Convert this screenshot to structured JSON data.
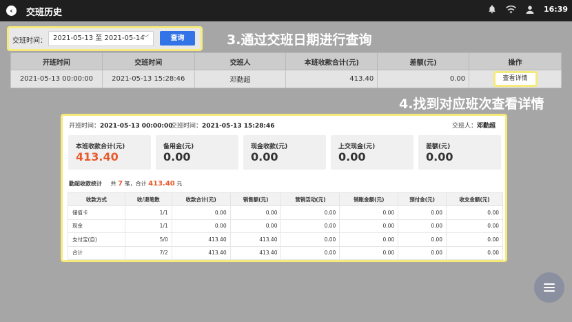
{
  "topbar": {
    "title": "交班历史",
    "time": "16:39"
  },
  "filter": {
    "label": "交班时间：",
    "date_range": "2021-05-13 至 2021-05-14",
    "query_button": "查询"
  },
  "annotations": {
    "step3": "3.通过交班日期进行查询",
    "step4": "4.找到对应班次查看详情"
  },
  "history_table": {
    "headers": [
      "开班时间",
      "交班时间",
      "交班人",
      "本班收款合计(元)",
      "差额(元)",
      "操作"
    ],
    "rows": [
      {
        "start": "2021-05-13 00:00:00",
        "end": "2021-05-13 15:28:46",
        "person": "邓勤超",
        "total": "413.40",
        "diff": "0.00",
        "action": "查看详情"
      }
    ]
  },
  "detail": {
    "start_label": "开班时间：",
    "start_value": "2021-05-13 00:00:00",
    "end_label": "交班时间：",
    "end_value": "2021-05-13 15:28:46",
    "person_label": "交班人：",
    "person_value": "邓勤超",
    "cards": [
      {
        "label": "本班收款合计(元)",
        "value": "413.40"
      },
      {
        "label": "备用金(元)",
        "value": "0.00"
      },
      {
        "label": "现金收款(元)",
        "value": "0.00"
      },
      {
        "label": "上交现金(元)",
        "value": "0.00"
      },
      {
        "label": "差额(元)",
        "value": "0.00"
      }
    ],
    "stats": {
      "title": "勤超收款统计",
      "prefix": "共",
      "count": "7",
      "mid": "笔，合计",
      "amount": "413.40",
      "suffix": "元"
    },
    "table": {
      "headers": [
        "收款方式",
        "收/退笔数",
        "收款合计(元)",
        "销售额(元)",
        "营销活动(元)",
        "销账金额(元)",
        "预付金(元)",
        "收支金额(元)"
      ],
      "rows": [
        [
          "储值卡",
          "1/1",
          "0.00",
          "0.00",
          "0.00",
          "0.00",
          "0.00",
          "0.00"
        ],
        [
          "现金",
          "1/1",
          "0.00",
          "0.00",
          "0.00",
          "0.00",
          "0.00",
          "0.00"
        ],
        [
          "支付宝(自)",
          "5/0",
          "413.40",
          "413.40",
          "0.00",
          "0.00",
          "0.00",
          "0.00"
        ],
        [
          "合计",
          "7/2",
          "413.40",
          "413.40",
          "0.00",
          "0.00",
          "0.00",
          "0.00"
        ]
      ]
    }
  },
  "colors": {
    "accent": "#3273e8",
    "highlight": "#f5ea7a",
    "amount": "#e85a2c"
  }
}
